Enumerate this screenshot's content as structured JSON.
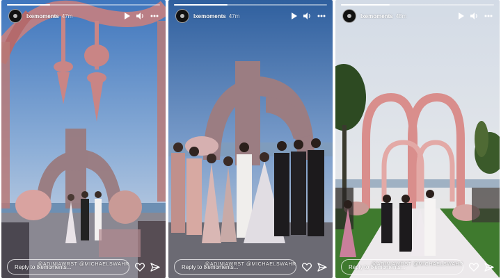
{
  "stories": [
    {
      "username": "lxemoments",
      "time_ago": "47m",
      "progress": 0.28,
      "credit": "@ADINIAWRST @MICHAELSWAHR",
      "reply_placeholder": "Reply to lxemoments..."
    },
    {
      "username": "lxemoments",
      "time_ago": "47m",
      "progress": 0.35,
      "credit": "@ADINIAWRST @MICHAELSWAHR",
      "reply_placeholder": "Reply to lxemoments..."
    },
    {
      "username": "lxemoments",
      "time_ago": "48m",
      "progress": 0.32,
      "credit": "@ADINIAWRST @MICHAELSWAHR",
      "reply_placeholder": "Reply to lxemoments..."
    }
  ],
  "icons": {
    "play": "play-icon",
    "volume": "volume-icon",
    "more": "more-options-icon",
    "like": "heart-icon",
    "share": "send-icon"
  },
  "colors": {
    "sky_top": "#4a7fc1",
    "sky_bottom": "#cfdaea",
    "drape": "#9c7a7a",
    "floral": "#d9908f",
    "lawn": "#3e7a2e"
  }
}
